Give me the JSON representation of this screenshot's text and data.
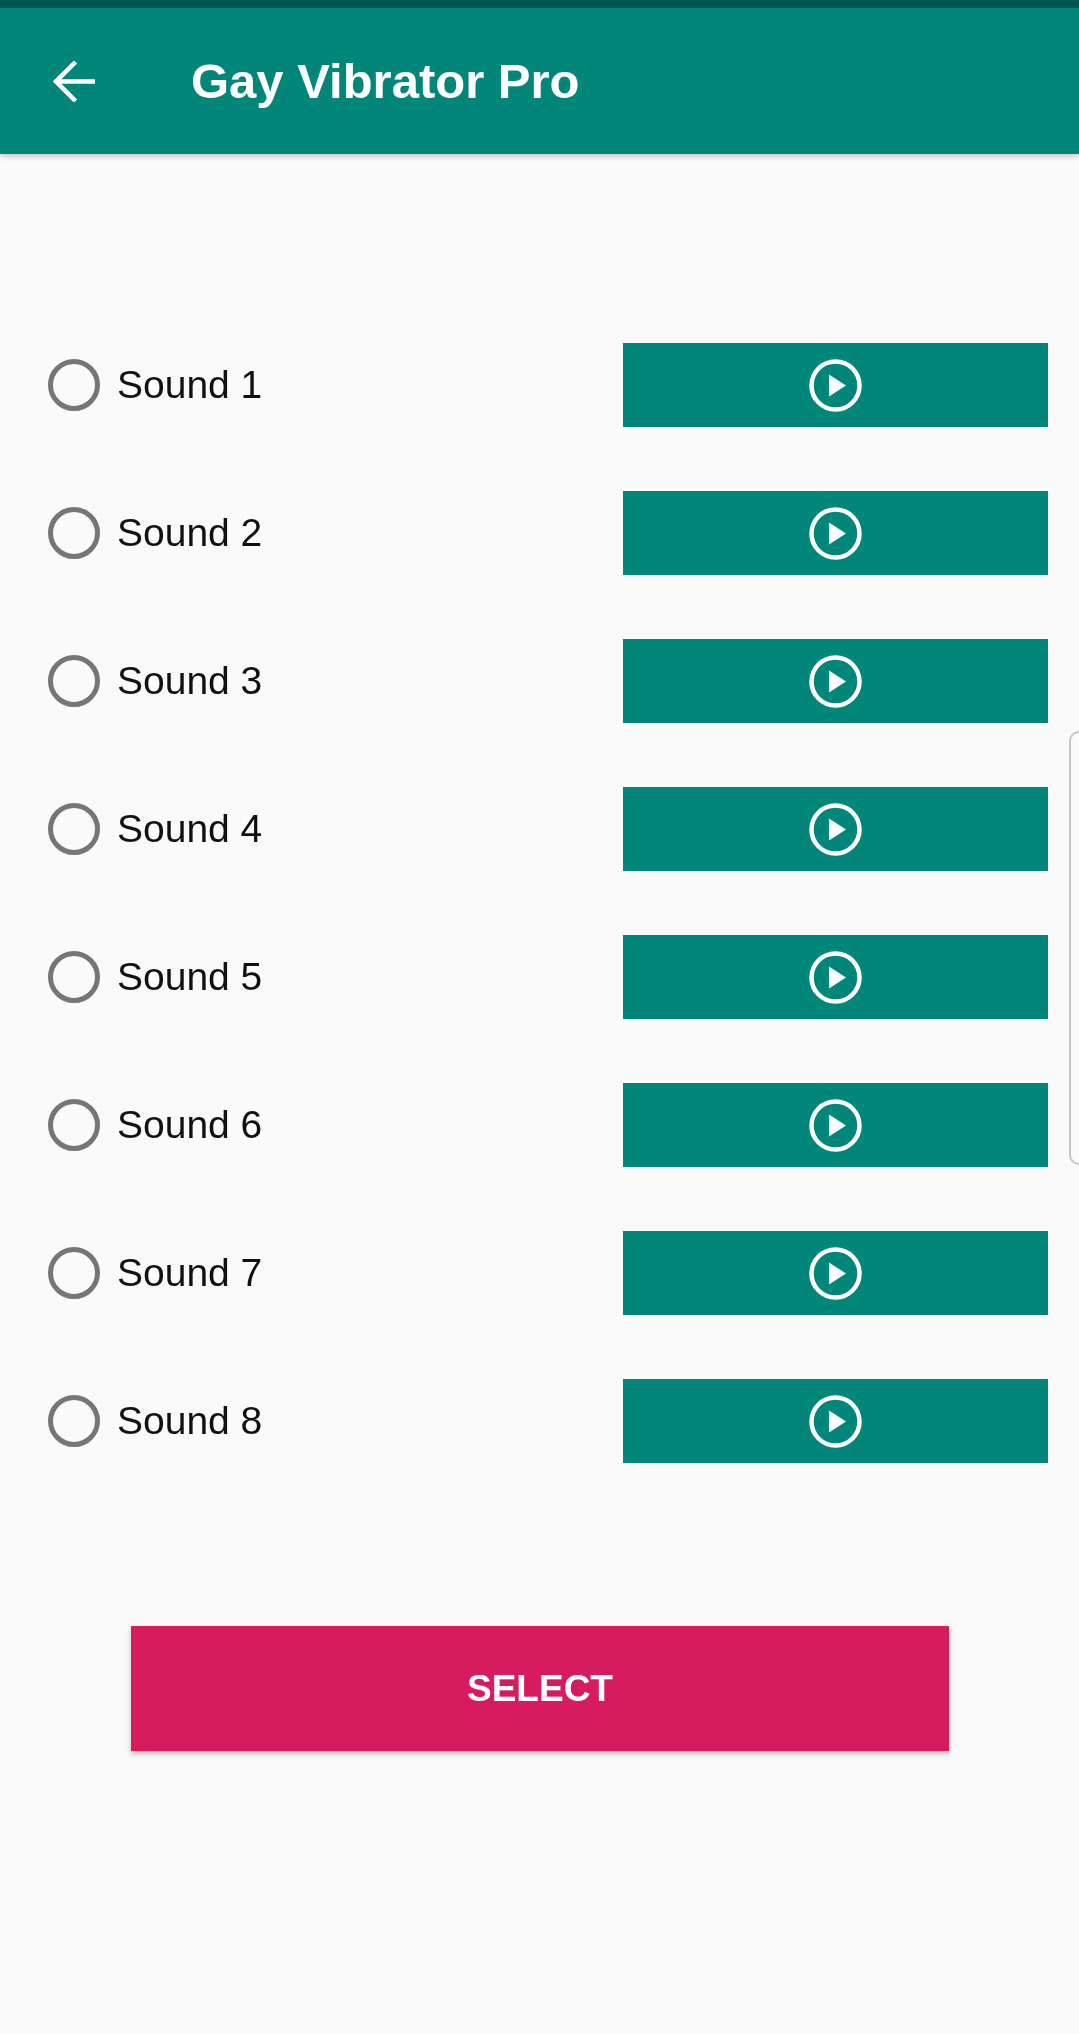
{
  "app_bar": {
    "title": "Gay Vibrator Pro"
  },
  "sounds": [
    {
      "label": "Sound 1",
      "selected": false
    },
    {
      "label": "Sound 2",
      "selected": false
    },
    {
      "label": "Sound 3",
      "selected": false
    },
    {
      "label": "Sound 4",
      "selected": false
    },
    {
      "label": "Sound 5",
      "selected": false
    },
    {
      "label": "Sound 6",
      "selected": false
    },
    {
      "label": "Sound 7",
      "selected": false
    },
    {
      "label": "Sound 8",
      "selected": false
    }
  ],
  "select_button": {
    "label": "SELECT"
  }
}
